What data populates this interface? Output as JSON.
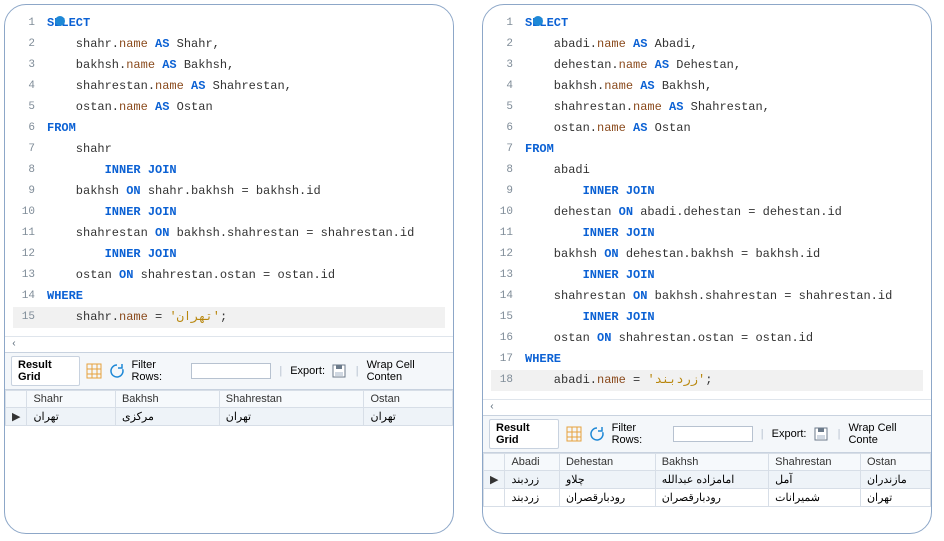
{
  "left": {
    "dot": true,
    "lines": [
      {
        "n": "1",
        "tokens": [
          {
            "t": "SELECT",
            "c": "kw"
          }
        ]
      },
      {
        "n": "2",
        "tokens": [
          {
            "t": "    shahr.",
            "c": "plain"
          },
          {
            "t": "name",
            "c": "fld"
          },
          {
            "t": " ",
            "c": "plain"
          },
          {
            "t": "AS",
            "c": "kw"
          },
          {
            "t": " Shahr,",
            "c": "plain"
          }
        ]
      },
      {
        "n": "3",
        "tokens": [
          {
            "t": "    bakhsh.",
            "c": "plain"
          },
          {
            "t": "name",
            "c": "fld"
          },
          {
            "t": " ",
            "c": "plain"
          },
          {
            "t": "AS",
            "c": "kw"
          },
          {
            "t": " Bakhsh,",
            "c": "plain"
          }
        ]
      },
      {
        "n": "4",
        "tokens": [
          {
            "t": "    shahrestan.",
            "c": "plain"
          },
          {
            "t": "name",
            "c": "fld"
          },
          {
            "t": " ",
            "c": "plain"
          },
          {
            "t": "AS",
            "c": "kw"
          },
          {
            "t": " Shahrestan,",
            "c": "plain"
          }
        ]
      },
      {
        "n": "5",
        "tokens": [
          {
            "t": "    ostan.",
            "c": "plain"
          },
          {
            "t": "name",
            "c": "fld"
          },
          {
            "t": " ",
            "c": "plain"
          },
          {
            "t": "AS",
            "c": "kw"
          },
          {
            "t": " Ostan",
            "c": "plain"
          }
        ]
      },
      {
        "n": "6",
        "tokens": [
          {
            "t": "FROM",
            "c": "kw"
          }
        ]
      },
      {
        "n": "7",
        "tokens": [
          {
            "t": "    shahr",
            "c": "plain"
          }
        ]
      },
      {
        "n": "8",
        "tokens": [
          {
            "t": "        ",
            "c": "plain"
          },
          {
            "t": "INNER JOIN",
            "c": "kw"
          }
        ]
      },
      {
        "n": "9",
        "tokens": [
          {
            "t": "    bakhsh ",
            "c": "plain"
          },
          {
            "t": "ON",
            "c": "kw"
          },
          {
            "t": " shahr.bakhsh = bakhsh.id",
            "c": "plain"
          }
        ]
      },
      {
        "n": "10",
        "tokens": [
          {
            "t": "        ",
            "c": "plain"
          },
          {
            "t": "INNER JOIN",
            "c": "kw"
          }
        ]
      },
      {
        "n": "11",
        "tokens": [
          {
            "t": "    shahrestan ",
            "c": "plain"
          },
          {
            "t": "ON",
            "c": "kw"
          },
          {
            "t": " bakhsh.shahrestan = shahrestan.id",
            "c": "plain"
          }
        ]
      },
      {
        "n": "12",
        "tokens": [
          {
            "t": "        ",
            "c": "plain"
          },
          {
            "t": "INNER JOIN",
            "c": "kw"
          }
        ]
      },
      {
        "n": "13",
        "tokens": [
          {
            "t": "    ostan ",
            "c": "plain"
          },
          {
            "t": "ON",
            "c": "kw"
          },
          {
            "t": " shahrestan.ostan = ostan.id",
            "c": "plain"
          }
        ]
      },
      {
        "n": "14",
        "tokens": [
          {
            "t": "WHERE",
            "c": "kw"
          }
        ]
      },
      {
        "n": "15",
        "last": true,
        "tokens": [
          {
            "t": "    shahr.",
            "c": "plain"
          },
          {
            "t": "name",
            "c": "fld"
          },
          {
            "t": " = ",
            "c": "plain"
          },
          {
            "t": "'تهران'",
            "c": "str"
          },
          {
            "t": ";",
            "c": "plain"
          }
        ]
      }
    ],
    "toolbar": {
      "tab": "Result Grid",
      "filter_label": "Filter Rows:",
      "filter_value": "",
      "export_label": "Export:",
      "wrap_label": "Wrap Cell Conten"
    },
    "grid": {
      "headers": [
        "Shahr",
        "Bakhsh",
        "Shahrestan",
        "Ostan"
      ],
      "rows": [
        {
          "sel": true,
          "cells": [
            "تهران",
            "مرکزی",
            "تهران",
            "تهران"
          ]
        }
      ]
    }
  },
  "right": {
    "dot": true,
    "lines": [
      {
        "n": "1",
        "tokens": [
          {
            "t": "SELECT",
            "c": "kw"
          }
        ]
      },
      {
        "n": "2",
        "tokens": [
          {
            "t": "    abadi.",
            "c": "plain"
          },
          {
            "t": "name",
            "c": "fld"
          },
          {
            "t": " ",
            "c": "plain"
          },
          {
            "t": "AS",
            "c": "kw"
          },
          {
            "t": " Abadi,",
            "c": "plain"
          }
        ]
      },
      {
        "n": "3",
        "tokens": [
          {
            "t": "    dehestan.",
            "c": "plain"
          },
          {
            "t": "name",
            "c": "fld"
          },
          {
            "t": " ",
            "c": "plain"
          },
          {
            "t": "AS",
            "c": "kw"
          },
          {
            "t": " Dehestan,",
            "c": "plain"
          }
        ]
      },
      {
        "n": "4",
        "tokens": [
          {
            "t": "    bakhsh.",
            "c": "plain"
          },
          {
            "t": "name",
            "c": "fld"
          },
          {
            "t": " ",
            "c": "plain"
          },
          {
            "t": "AS",
            "c": "kw"
          },
          {
            "t": " Bakhsh,",
            "c": "plain"
          }
        ]
      },
      {
        "n": "5",
        "tokens": [
          {
            "t": "    shahrestan.",
            "c": "plain"
          },
          {
            "t": "name",
            "c": "fld"
          },
          {
            "t": " ",
            "c": "plain"
          },
          {
            "t": "AS",
            "c": "kw"
          },
          {
            "t": " Shahrestan,",
            "c": "plain"
          }
        ]
      },
      {
        "n": "6",
        "tokens": [
          {
            "t": "    ostan.",
            "c": "plain"
          },
          {
            "t": "name",
            "c": "fld"
          },
          {
            "t": " ",
            "c": "plain"
          },
          {
            "t": "AS",
            "c": "kw"
          },
          {
            "t": " Ostan",
            "c": "plain"
          }
        ]
      },
      {
        "n": "7",
        "tokens": [
          {
            "t": "FROM",
            "c": "kw"
          }
        ]
      },
      {
        "n": "8",
        "tokens": [
          {
            "t": "    abadi",
            "c": "plain"
          }
        ]
      },
      {
        "n": "9",
        "tokens": [
          {
            "t": "        ",
            "c": "plain"
          },
          {
            "t": "INNER JOIN",
            "c": "kw"
          }
        ]
      },
      {
        "n": "10",
        "tokens": [
          {
            "t": "    dehestan ",
            "c": "plain"
          },
          {
            "t": "ON",
            "c": "kw"
          },
          {
            "t": " abadi.dehestan = dehestan.id",
            "c": "plain"
          }
        ]
      },
      {
        "n": "11",
        "tokens": [
          {
            "t": "        ",
            "c": "plain"
          },
          {
            "t": "INNER JOIN",
            "c": "kw"
          }
        ]
      },
      {
        "n": "12",
        "tokens": [
          {
            "t": "    bakhsh ",
            "c": "plain"
          },
          {
            "t": "ON",
            "c": "kw"
          },
          {
            "t": " dehestan.bakhsh = bakhsh.id",
            "c": "plain"
          }
        ]
      },
      {
        "n": "13",
        "tokens": [
          {
            "t": "        ",
            "c": "plain"
          },
          {
            "t": "INNER JOIN",
            "c": "kw"
          }
        ]
      },
      {
        "n": "14",
        "tokens": [
          {
            "t": "    shahrestan ",
            "c": "plain"
          },
          {
            "t": "ON",
            "c": "kw"
          },
          {
            "t": " bakhsh.shahrestan = shahrestan.id",
            "c": "plain"
          }
        ]
      },
      {
        "n": "15",
        "tokens": [
          {
            "t": "        ",
            "c": "plain"
          },
          {
            "t": "INNER JOIN",
            "c": "kw"
          }
        ]
      },
      {
        "n": "16",
        "tokens": [
          {
            "t": "    ostan ",
            "c": "plain"
          },
          {
            "t": "ON",
            "c": "kw"
          },
          {
            "t": " shahrestan.ostan = ostan.id",
            "c": "plain"
          }
        ]
      },
      {
        "n": "17",
        "tokens": [
          {
            "t": "WHERE",
            "c": "kw"
          }
        ]
      },
      {
        "n": "18",
        "last": true,
        "tokens": [
          {
            "t": "    abadi.",
            "c": "plain"
          },
          {
            "t": "name",
            "c": "fld"
          },
          {
            "t": " = ",
            "c": "plain"
          },
          {
            "t": "'زردبند'",
            "c": "str"
          },
          {
            "t": ";",
            "c": "plain"
          }
        ]
      }
    ],
    "toolbar": {
      "tab": "Result Grid",
      "filter_label": "Filter Rows:",
      "filter_value": "",
      "export_label": "Export:",
      "wrap_label": "Wrap Cell Conte"
    },
    "grid": {
      "headers": [
        "Abadi",
        "Dehestan",
        "Bakhsh",
        "Shahrestan",
        "Ostan"
      ],
      "rows": [
        {
          "sel": true,
          "cells": [
            "زردبند",
            "چلاو",
            "امامزاده عبدالله",
            "آمل",
            "مازندران"
          ]
        },
        {
          "sel": false,
          "cells": [
            "زردبند",
            "رودبارقصران",
            "رودبارقصران",
            "شمیرانات",
            "تهران"
          ]
        }
      ]
    }
  }
}
